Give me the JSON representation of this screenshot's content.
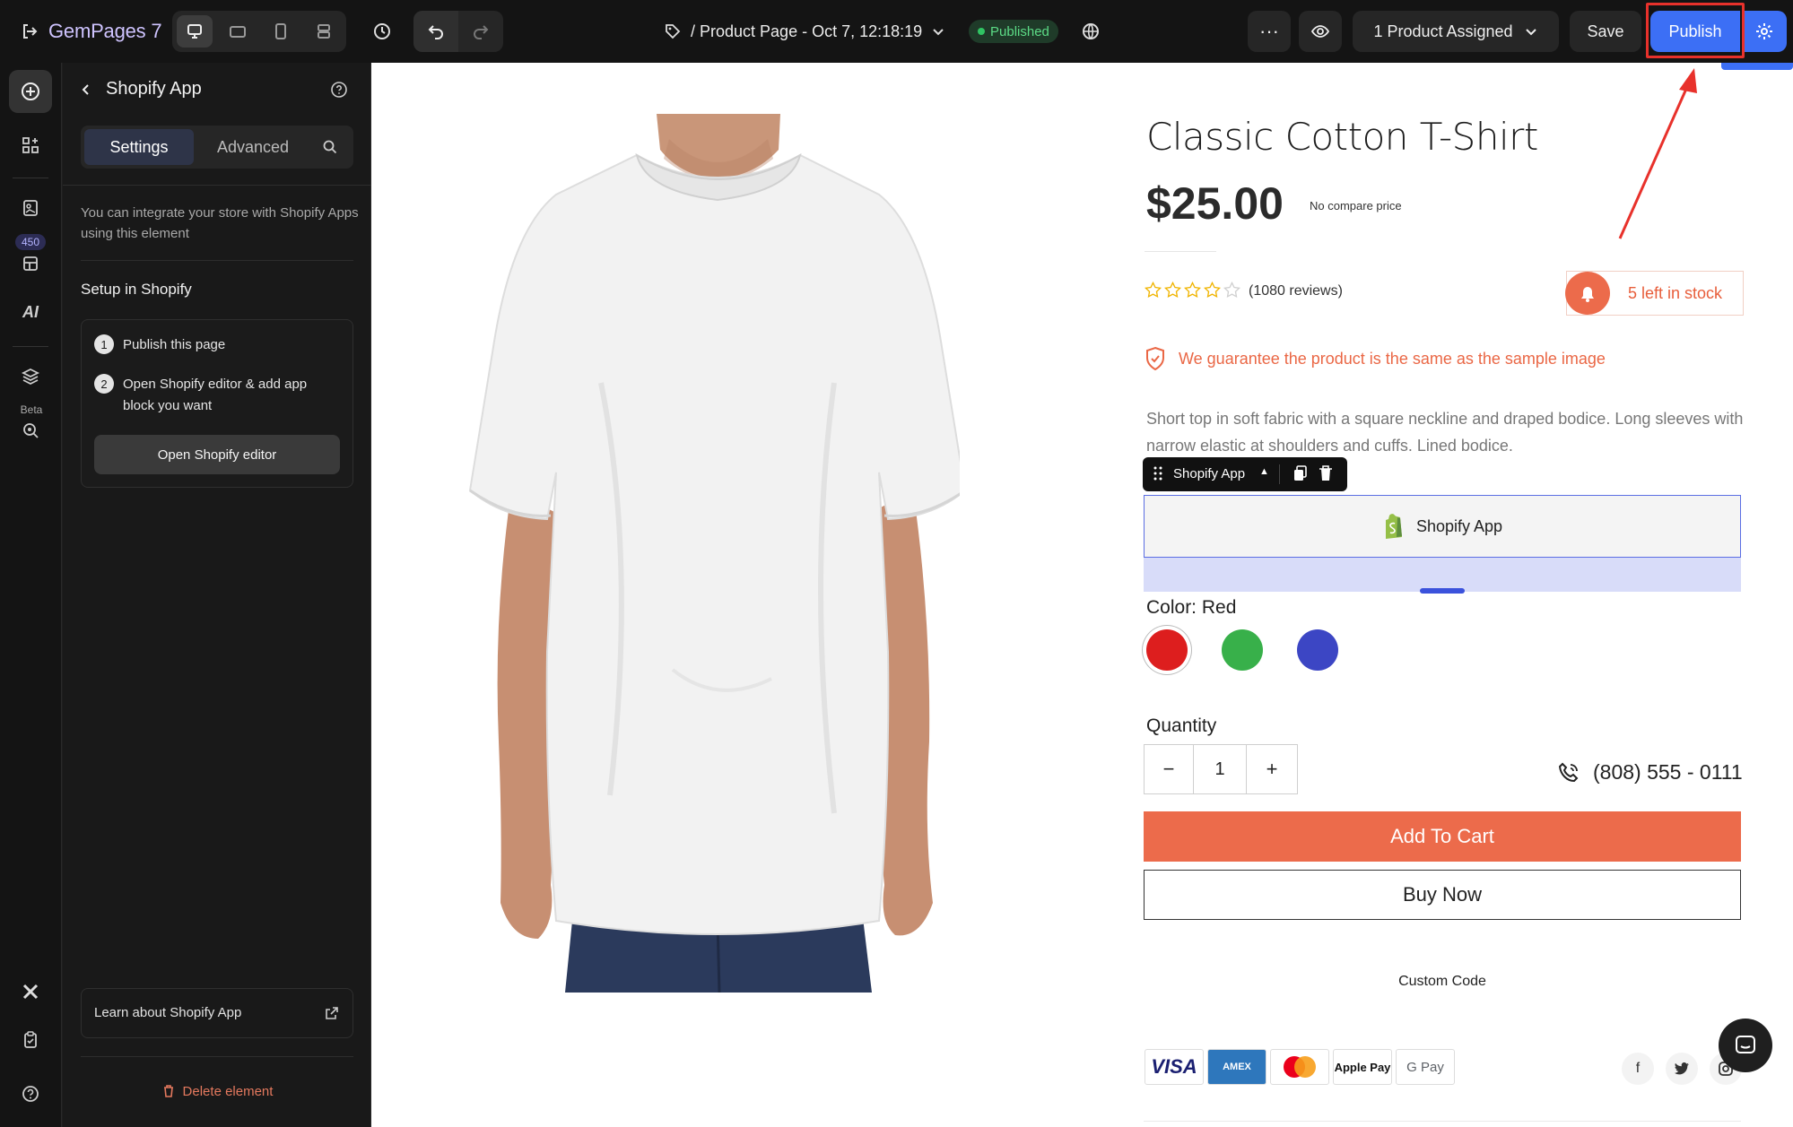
{
  "topbar": {
    "logo": "GemPages 7",
    "page_name": "/ Product Page - Oct 7, 12:18:19",
    "status_badge": "Published",
    "more_label": "···",
    "assigned_label": "1 Product Assigned",
    "save_label": "Save",
    "publish_label": "Publish"
  },
  "rail": {
    "badge_count": "450",
    "ai_label": "AI",
    "beta_label": "Beta"
  },
  "panel": {
    "title": "Shopify App",
    "tabs": [
      {
        "label": "Settings",
        "active": true
      },
      {
        "label": "Advanced",
        "active": false
      }
    ],
    "intro": "You can integrate your store with Shopify Apps using this element",
    "setup_title": "Setup in Shopify",
    "steps": [
      {
        "num": "1",
        "text": "Publish this page"
      },
      {
        "num": "2",
        "text": "Open Shopify editor & add app block you want"
      }
    ],
    "open_editor_label": "Open Shopify editor",
    "learn_label": "Learn about Shopify App",
    "delete_label": "Delete element"
  },
  "product": {
    "title": "Classic Cotton T-Shirt",
    "price": "$25.00",
    "compare_price": "No compare price",
    "rating": 4,
    "rating_max": 5,
    "reviews": "(1080 reviews)",
    "stock": "5 left in stock",
    "guarantee": "We guarantee the product is the same as the sample image",
    "description": "Short top in soft fabric with a square neckline and draped bodice. Long sleeves with narrow elastic at shoulders and cuffs. Lined bodice.",
    "app_toolbar_label": "Shopify App",
    "app_block_label": "Shopify App",
    "color_label": "Color: Red",
    "colors": [
      {
        "name": "Red",
        "hex": "#dd1e1e",
        "selected": true
      },
      {
        "name": "Green",
        "hex": "#38b04a",
        "selected": false
      },
      {
        "name": "Blue",
        "hex": "#3c46c4",
        "selected": false
      }
    ],
    "quantity_label": "Quantity",
    "quantity_minus": "−",
    "quantity_value": "1",
    "quantity_plus": "+",
    "phone": "(808) 555 - 0111",
    "add_to_cart": "Add To Cart",
    "buy_now": "Buy Now",
    "custom_code": "Custom Code",
    "payments": [
      "VISA",
      "AMEX",
      "Mastercard",
      "Apple Pay",
      "G Pay"
    ],
    "social": [
      "f",
      "t",
      "ig"
    ]
  },
  "colors": {
    "accent_blue": "#3c6ff5",
    "brand_orange": "#ec6b4b",
    "highlight_red": "#e8312b",
    "published_green": "#30c463"
  }
}
